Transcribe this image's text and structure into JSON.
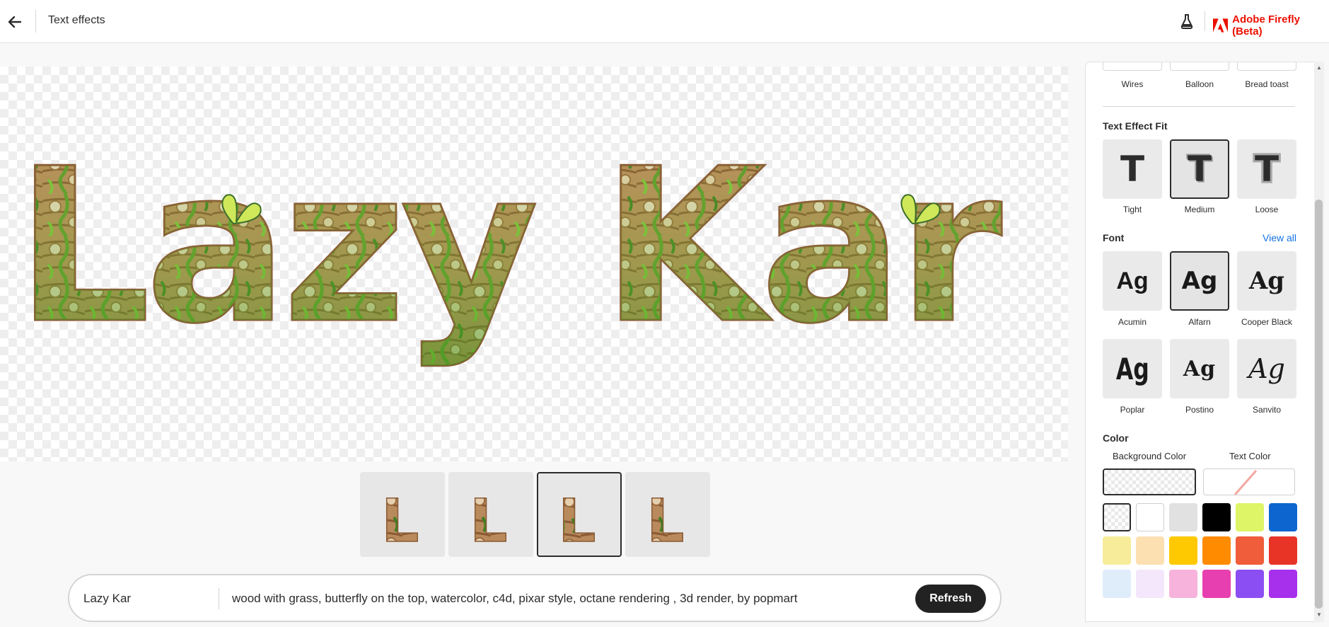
{
  "header": {
    "title": "Text effects",
    "brand": "Adobe Firefly (Beta)"
  },
  "canvas": {
    "text": "Lazy Kar"
  },
  "variations": {
    "count": 4,
    "selected_index": 2
  },
  "prompt_bar": {
    "text_value": "Lazy Kar",
    "prompt_value": "wood with grass, butterfly on the top, watercolor, c4d, pixar style, octane rendering , 3d render, by popmart",
    "refresh_label": "Refresh"
  },
  "panel": {
    "styles": [
      "Wires",
      "Balloon",
      "Bread toast"
    ],
    "fit_title": "Text Effect Fit",
    "fit_options": [
      "Tight",
      "Medium",
      "Loose"
    ],
    "fit_selected": "Medium",
    "font_title": "Font",
    "view_all": "View all",
    "fonts": [
      "Acumin",
      "Alfarn",
      "Cooper Black",
      "Poplar",
      "Postino",
      "Sanvito"
    ],
    "font_selected": "Alfarn",
    "color_title": "Color",
    "background_color_label": "Background Color",
    "text_color_label": "Text Color",
    "swatches_row1": [
      "transparent",
      "#ffffff",
      "#e1e1e1",
      "#000000",
      "#ddf566",
      "#0d66d0"
    ],
    "swatches_row2": [
      "#f7ec9a",
      "#fde0b2",
      "#fec900",
      "#ff8b00",
      "#f05d3a",
      "#e73427"
    ],
    "swatches_row3": [
      "#dfedfb",
      "#f4e7fb",
      "#f7b3db",
      "#e73fb0",
      "#8a4ef2",
      "#a630ec"
    ]
  }
}
